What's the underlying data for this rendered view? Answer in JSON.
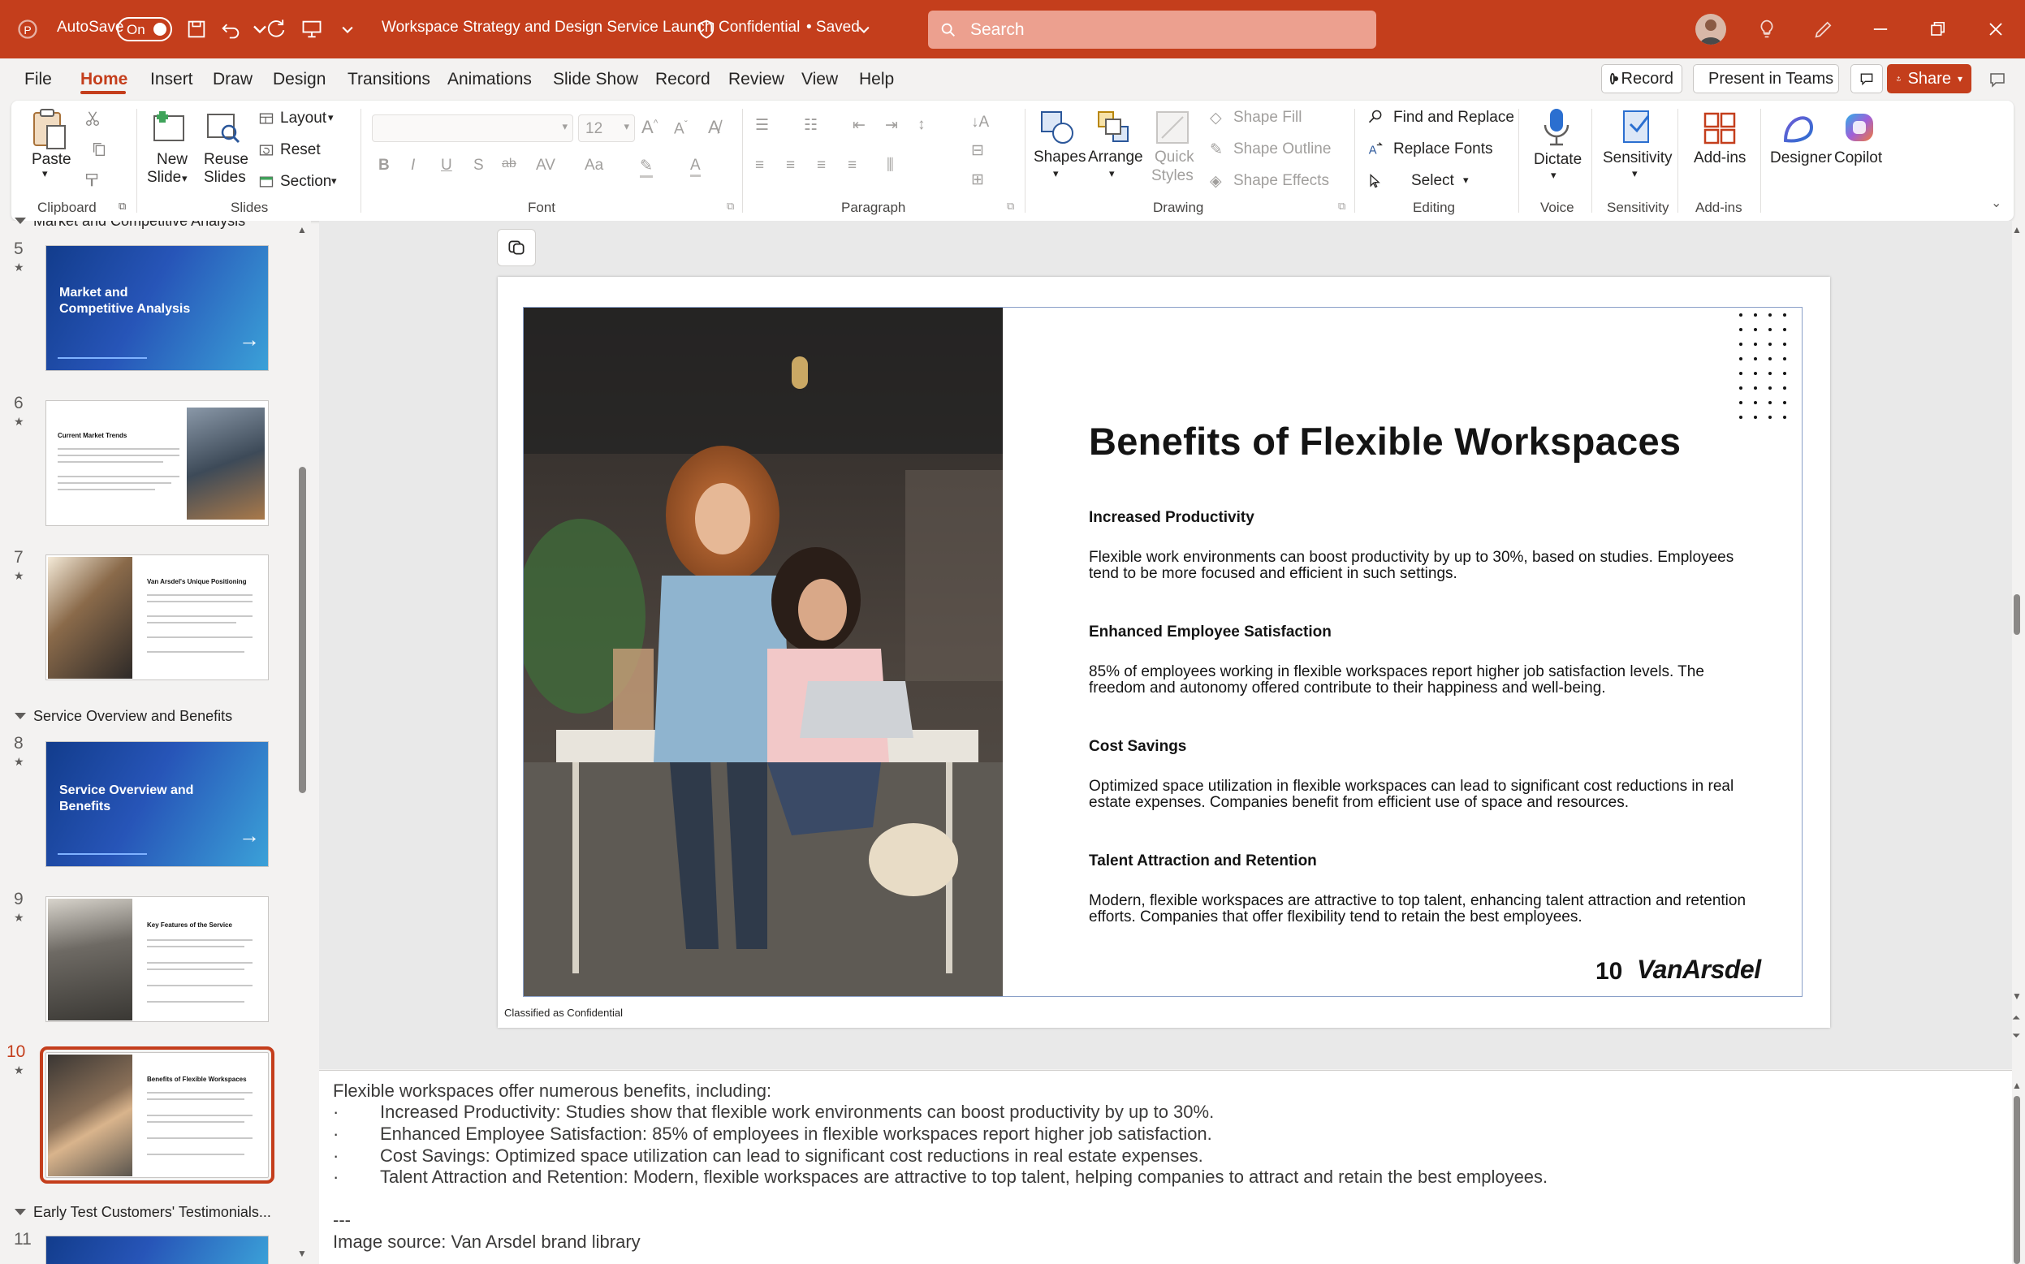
{
  "titlebar": {
    "autosave_label": "AutoSave",
    "autosave_state": "On",
    "doc_title": "Workspace Strategy and Design Service Launch",
    "sensitivity": "Confidential",
    "saved_state": "• Saved",
    "search_placeholder": "Search"
  },
  "menu": {
    "items": [
      "File",
      "Home",
      "Insert",
      "Draw",
      "Design",
      "Transitions",
      "Animations",
      "Slide Show",
      "Record",
      "Review",
      "View",
      "Help"
    ],
    "active": "Home",
    "record_btn": "Record",
    "present_btn": "Present in Teams",
    "share_btn": "Share"
  },
  "ribbon": {
    "clipboard": {
      "paste": "Paste",
      "group": "Clipboard"
    },
    "slides": {
      "new_slide_1": "New",
      "new_slide_2": "Slide",
      "reuse_1": "Reuse",
      "reuse_2": "Slides",
      "layout": "Layout",
      "reset": "Reset",
      "section": "Section",
      "group": "Slides"
    },
    "font": {
      "size": "12",
      "group": "Font"
    },
    "paragraph": {
      "group": "Paragraph"
    },
    "drawing": {
      "shapes": "Shapes",
      "arrange": "Arrange",
      "quick_1": "Quick",
      "quick_2": "Styles",
      "fill": "Shape Fill",
      "outline": "Shape Outline",
      "effects": "Shape Effects",
      "group": "Drawing"
    },
    "editing": {
      "find": "Find and Replace",
      "replace_fonts": "Replace Fonts",
      "select": "Select",
      "group": "Editing"
    },
    "voice": {
      "dictate": "Dictate",
      "group": "Voice"
    },
    "sensitivity": {
      "label": "Sensitivity",
      "group": "Sensitivity"
    },
    "addins": {
      "label": "Add-ins",
      "group": "Add-ins"
    },
    "designer": "Designer",
    "copilot": "Copilot"
  },
  "thumbnails": {
    "section_partial": "Market and Competitive Analysis",
    "section_service": "Service Overview and Benefits",
    "section_testimonials": "Early Test Customers' Testimonials...",
    "slides": [
      {
        "num": "5",
        "title": "Market and Competitive Analysis"
      },
      {
        "num": "6",
        "title": "Current Market Trends"
      },
      {
        "num": "7",
        "title": "Van Arsdel's Unique Positioning"
      },
      {
        "num": "8",
        "title": "Service Overview and Benefits"
      },
      {
        "num": "9",
        "title": "Key Features of the Service"
      },
      {
        "num": "10",
        "title": "Benefits of Flexible Workspaces"
      },
      {
        "num": "11",
        "title": ""
      }
    ],
    "star": "★"
  },
  "slide": {
    "title": "Benefits of Flexible Workspaces",
    "benefits": [
      {
        "heading": "Increased Productivity",
        "body": "Flexible work environments can boost productivity by up to 30%, based on studies. Employees tend to be more focused and efficient in such settings."
      },
      {
        "heading": "Enhanced Employee Satisfaction",
        "body": "85% of employees working in flexible workspaces report higher job satisfaction levels. The freedom and autonomy offered contribute to their happiness and well-being."
      },
      {
        "heading": "Cost Savings",
        "body": "Optimized space utilization in flexible workspaces can lead to significant cost reductions in real estate expenses. Companies benefit from efficient use of space and resources."
      },
      {
        "heading": "Talent Attraction and Retention",
        "body": "Modern, flexible workspaces are attractive to top talent, enhancing talent attraction and retention efforts. Companies that offer flexibility tend to retain the best employees."
      }
    ],
    "page_number": "10",
    "brand": "VanArsdel",
    "classification": "Classified as Confidential"
  },
  "notes": {
    "intro": "Flexible workspaces offer numerous benefits, including:",
    "bullet": "·",
    "items": [
      "Increased Productivity: Studies show that flexible work environments can boost productivity by up to 30%.",
      "Enhanced Employee Satisfaction: 85% of employees in flexible workspaces report higher job satisfaction.",
      "Cost Savings: Optimized space utilization can lead to significant cost reductions in real estate expenses.",
      "Talent Attraction and Retention: Modern, flexible workspaces are attractive to top talent, helping companies to attract and retain the best employees."
    ],
    "divider": "---",
    "source": "Image source: Van Arsdel brand library"
  },
  "colors": {
    "accent": "#c43e1c",
    "slide_blue": "#2755b8"
  }
}
